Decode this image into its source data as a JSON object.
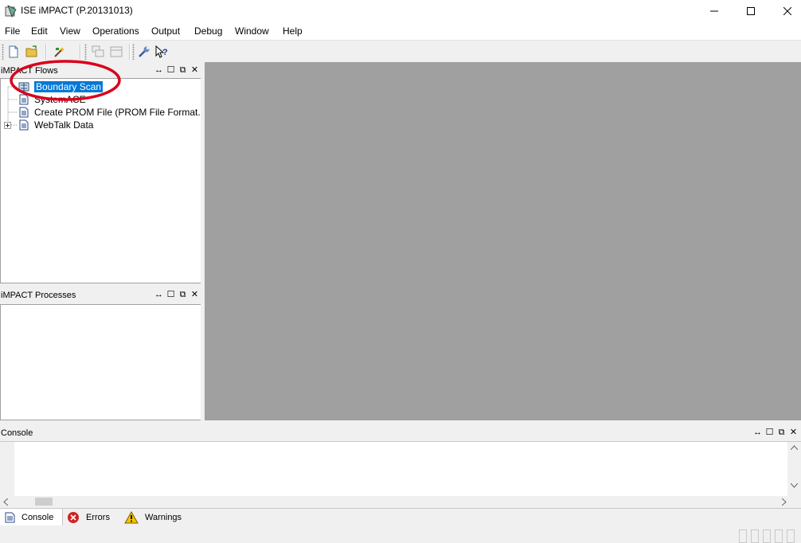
{
  "window": {
    "title": "ISE iMPACT (P.20131013)"
  },
  "menu": [
    "File",
    "Edit",
    "View",
    "Operations",
    "Output",
    "Debug",
    "Window",
    "Help"
  ],
  "flows_panel": {
    "title": "iMPACT Flows",
    "items": [
      {
        "label": "Boundary Scan",
        "icon": "boundary-scan-icon",
        "selected": true
      },
      {
        "label": "SystemACE",
        "icon": "document-icon"
      },
      {
        "label": "Create PROM File (PROM File Format...",
        "icon": "document-icon"
      },
      {
        "label": "WebTalk Data",
        "icon": "document-icon",
        "expandable": true
      }
    ]
  },
  "processes_panel": {
    "title": "iMPACT Processes"
  },
  "console_panel": {
    "title": "Console"
  },
  "tabs": [
    {
      "label": "Console",
      "icon": "console-icon",
      "active": true
    },
    {
      "label": "Errors",
      "icon": "error-icon"
    },
    {
      "label": "Warnings",
      "icon": "warning-icon"
    }
  ],
  "colors": {
    "selection": "#0078d7",
    "workspace": "#a0a0a0",
    "annotation": "#d9001b"
  }
}
